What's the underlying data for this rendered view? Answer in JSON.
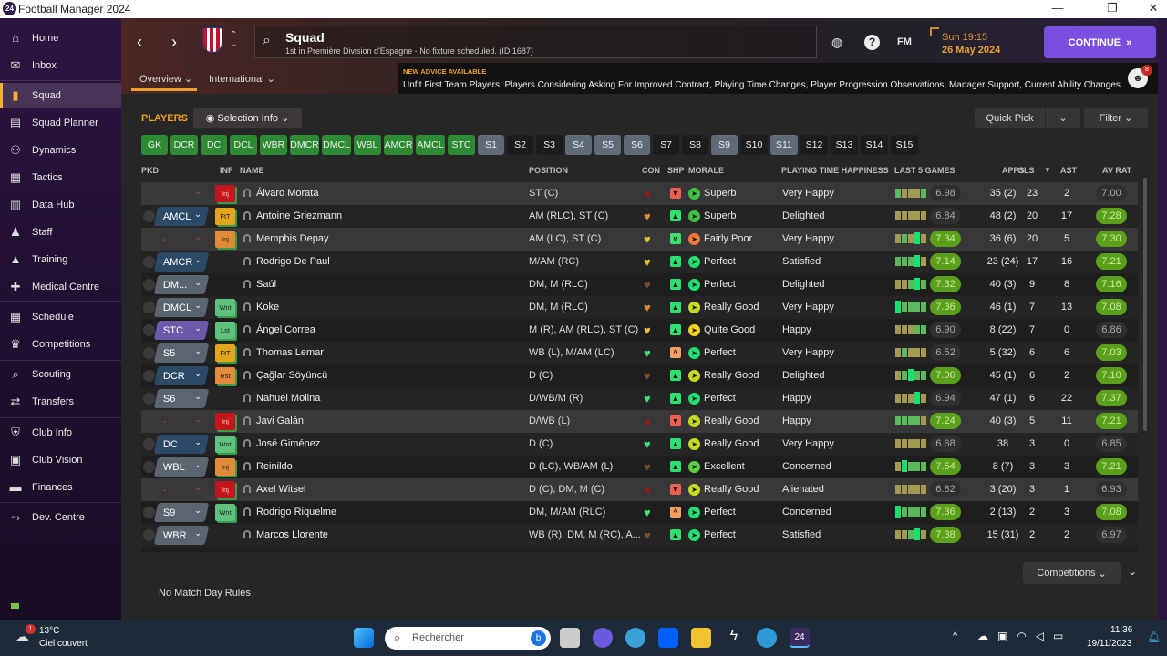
{
  "window": {
    "title": "Football Manager 2024",
    "logo": "24"
  },
  "sidebar": {
    "items": [
      {
        "label": "Home",
        "icon": "home-icon",
        "g": "⌂"
      },
      {
        "label": "Inbox",
        "icon": "inbox-icon",
        "g": "✉"
      },
      {
        "label": "Squad",
        "icon": "squad-icon",
        "g": "▮",
        "active": true
      },
      {
        "label": "Squad Planner",
        "icon": "clipboard-icon",
        "g": "▤"
      },
      {
        "label": "Dynamics",
        "icon": "dynamics-icon",
        "g": "⚇"
      },
      {
        "label": "Tactics",
        "icon": "tactics-icon",
        "g": "▦"
      },
      {
        "label": "Data Hub",
        "icon": "data-hub-icon",
        "g": "▥"
      },
      {
        "label": "Staff",
        "icon": "staff-icon",
        "g": "♟"
      },
      {
        "label": "Training",
        "icon": "training-icon",
        "g": "▲"
      },
      {
        "label": "Medical Centre",
        "icon": "medical-icon",
        "g": "✚"
      },
      {
        "label": "Schedule",
        "icon": "calendar-icon",
        "g": "▦"
      },
      {
        "label": "Competitions",
        "icon": "trophy-icon",
        "g": "♛"
      },
      {
        "label": "Scouting",
        "icon": "scouting-icon",
        "g": "⌕"
      },
      {
        "label": "Transfers",
        "icon": "transfers-icon",
        "g": "⇄"
      },
      {
        "label": "Club Info",
        "icon": "shield-icon",
        "g": "⛨"
      },
      {
        "label": "Club Vision",
        "icon": "vision-icon",
        "g": "▣"
      },
      {
        "label": "Finances",
        "icon": "finances-icon",
        "g": "▬"
      },
      {
        "label": "Dev. Centre",
        "icon": "dev-centre-icon",
        "g": "⤳"
      }
    ]
  },
  "header": {
    "title": "Squad",
    "subtitle": "1st in Première Division d'Espagne - No fixture scheduled. (ID:1687)",
    "tabs": [
      {
        "label": "Overview"
      },
      {
        "label": "International"
      }
    ],
    "time": "Sun 19:15",
    "date": "26 May 2024",
    "fm_label": "FM",
    "continue_label": "CONTINUE",
    "advice_title": "NEW ADVICE AVAILABLE",
    "advice_text": "Unfit First Team Players, Players Considering Asking For Improved Contract, Playing Time Changes, Player Progression Observations, Manager Support, Current Ability Changes",
    "notification_count": "8"
  },
  "squad": {
    "section_title": "PLAYERS",
    "selection_info": "Selection Info",
    "quick_pick": "Quick Pick",
    "filter": "Filter",
    "positions": [
      {
        "l": "GK",
        "s": "g"
      },
      {
        "l": "DCR",
        "s": "g"
      },
      {
        "l": "DC",
        "s": "g"
      },
      {
        "l": "DCL",
        "s": "g"
      },
      {
        "l": "WBR",
        "s": "g"
      },
      {
        "l": "DMCR",
        "s": "g"
      },
      {
        "l": "DMCL",
        "s": "g"
      },
      {
        "l": "WBL",
        "s": "g"
      },
      {
        "l": "AMCR",
        "s": "g"
      },
      {
        "l": "AMCL",
        "s": "g"
      },
      {
        "l": "STC",
        "s": "g"
      },
      {
        "l": "S1",
        "s": "s"
      },
      {
        "l": "S2",
        "s": "e"
      },
      {
        "l": "S3",
        "s": "e"
      },
      {
        "l": "S4",
        "s": "s"
      },
      {
        "l": "S5",
        "s": "s"
      },
      {
        "l": "S6",
        "s": "s"
      },
      {
        "l": "S7",
        "s": "e"
      },
      {
        "l": "S8",
        "s": "e"
      },
      {
        "l": "S9",
        "s": "s"
      },
      {
        "l": "S10",
        "s": "e"
      },
      {
        "l": "S11",
        "s": "s"
      },
      {
        "l": "S12",
        "s": "e"
      },
      {
        "l": "S13",
        "s": "e"
      },
      {
        "l": "S14",
        "s": "e"
      },
      {
        "l": "S15",
        "s": "e"
      }
    ],
    "columns": {
      "pkd": "PKD",
      "inf": "INF",
      "name": "NAME",
      "position": "POSITION",
      "con": "CON",
      "shp": "SHP",
      "morale": "MORALE",
      "pth": "PLAYING TIME HAPPINESS",
      "last5": "LAST 5 GAMES",
      "apps": "APPS",
      "gls": "GLS",
      "ast": "AST",
      "avrat": "AV RAT"
    },
    "rows": [
      {
        "pkd": "",
        "pc": "none",
        "inf": "Inj",
        "ic": "red",
        "name": "Álvaro Morata",
        "position": "ST (C)",
        "con": "injured",
        "shp": "down",
        "morale": "Superb",
        "pth": "Very Happy",
        "l5": "6.98",
        "bars": "gyyyg",
        "apps": "35 (2)",
        "gls": "23",
        "ast": "2",
        "avrat": "7.00",
        "hl": true
      },
      {
        "pkd": "AMCL",
        "pc": "blue",
        "inf": "FtT",
        "ic": "amber",
        "name": "Antoine Griezmann",
        "position": "AM (RLC), ST (C)",
        "con": "orange",
        "shp": "up",
        "morale": "Superb",
        "pth": "Delighted",
        "l5": "6.84",
        "bars": "yyyyy",
        "apps": "48 (2)",
        "gls": "20",
        "ast": "17",
        "avrat": "7.28"
      },
      {
        "pkd": "-",
        "pc": "none",
        "inf": "Inj",
        "ic": "orange",
        "name": "Memphis Depay",
        "position": "AM (LC), ST (C)",
        "con": "yellow",
        "shp": "chev-down",
        "morale": "Fairly Poor",
        "pth": "Very Happy",
        "l5": "7.34",
        "bars": "ygyGy",
        "apps": "36 (6)",
        "gls": "20",
        "ast": "5",
        "avrat": "7.30",
        "hl": true
      },
      {
        "pkd": "AMCR",
        "pc": "blue",
        "inf": "",
        "ic": "",
        "name": "Rodrigo De Paul",
        "position": "M/AM (RC)",
        "con": "yellow",
        "shp": "up",
        "morale": "Perfect",
        "pth": "Satisfied",
        "l5": "7.14",
        "bars": "gggGy",
        "apps": "23 (24)",
        "gls": "17",
        "ast": "16",
        "avrat": "7.21"
      },
      {
        "pkd": "DM...",
        "pc": "gray",
        "inf": "",
        "ic": "",
        "name": "Saúl",
        "position": "DM, M (RLC)",
        "con": "brown",
        "shp": "up",
        "morale": "Perfect",
        "pth": "Delighted",
        "l5": "7.32",
        "bars": "yygGg",
        "apps": "40 (3)",
        "gls": "9",
        "ast": "8",
        "avrat": "7.16"
      },
      {
        "pkd": "DMCL",
        "pc": "gray",
        "inf": "Wnt",
        "ic": "green",
        "name": "Koke",
        "position": "DM, M (RLC)",
        "con": "orange",
        "shp": "up",
        "morale": "Really Good",
        "pth": "Very Happy",
        "l5": "7.36",
        "bars": "Ggggg",
        "apps": "46 (1)",
        "gls": "7",
        "ast": "13",
        "avrat": "7.08"
      },
      {
        "pkd": "STC",
        "pc": "purple",
        "inf": "Lst",
        "ic": "green",
        "name": "Ángel Correa",
        "position": "M (R), AM (RLC), ST (C)",
        "con": "yellow",
        "shp": "up",
        "morale": "Quite Good",
        "pth": "Happy",
        "l5": "6.90",
        "bars": "yyygg",
        "apps": "8 (22)",
        "gls": "7",
        "ast": "0",
        "avrat": "6.86"
      },
      {
        "pkd": "S5",
        "pc": "gray",
        "inf": "FtT",
        "ic": "amber",
        "name": "Thomas Lemar",
        "position": "WB (L), M/AM (LC)",
        "con": "green",
        "shp": "chev-up",
        "morale": "Perfect",
        "pth": "Very Happy",
        "l5": "6.52",
        "bars": "ygyyy",
        "apps": "5 (32)",
        "gls": "6",
        "ast": "6",
        "avrat": "7.03"
      },
      {
        "pkd": "DCR",
        "pc": "blue",
        "inf": "Rst",
        "ic": "orange",
        "name": "Çağlar Söyüncü",
        "position": "D (C)",
        "con": "brown",
        "shp": "up",
        "morale": "Really Good",
        "pth": "Delighted",
        "l5": "7.06",
        "bars": "ygGgg",
        "apps": "45 (1)",
        "gls": "6",
        "ast": "2",
        "avrat": "7.10"
      },
      {
        "pkd": "S6",
        "pc": "gray",
        "inf": "",
        "ic": "",
        "name": "Nahuel Molina",
        "position": "D/WB/M (R)",
        "con": "green",
        "shp": "up",
        "morale": "Perfect",
        "pth": "Happy",
        "l5": "6.94",
        "bars": "yyyGy",
        "apps": "47 (1)",
        "gls": "6",
        "ast": "22",
        "avrat": "7.37"
      },
      {
        "pkd": "-",
        "pc": "none",
        "inf": "Inj",
        "ic": "red",
        "name": "Javi Galán",
        "position": "D/WB (L)",
        "con": "injured",
        "shp": "down",
        "morale": "Really Good",
        "pth": "Happy",
        "l5": "7.24",
        "bars": "ggggy",
        "apps": "40 (3)",
        "gls": "5",
        "ast": "11",
        "avrat": "7.21",
        "hl": true
      },
      {
        "pkd": "DC",
        "pc": "blue",
        "inf": "Wnt",
        "ic": "green",
        "name": "José Giménez",
        "position": "D (C)",
        "con": "green",
        "shp": "up",
        "morale": "Really Good",
        "pth": "Very Happy",
        "l5": "6.68",
        "bars": "yyyyy",
        "apps": "38",
        "gls": "3",
        "ast": "0",
        "avrat": "6.85"
      },
      {
        "pkd": "WBL",
        "pc": "gray",
        "inf": "Inj",
        "ic": "orange",
        "name": "Reinildo",
        "position": "D (LC), WB/AM (L)",
        "con": "brown",
        "shp": "up",
        "morale": "Excellent",
        "pth": "Concerned",
        "l5": "7.54",
        "bars": "yGggg",
        "apps": "8 (7)",
        "gls": "3",
        "ast": "3",
        "avrat": "7.21"
      },
      {
        "pkd": "-",
        "pc": "none",
        "inf": "Inj",
        "ic": "red",
        "name": "Axel Witsel",
        "position": "D (C), DM, M (C)",
        "con": "injured",
        "shp": "down",
        "morale": "Really Good",
        "pth": "Alienated",
        "l5": "6.82",
        "bars": "yyyyy",
        "apps": "3 (20)",
        "gls": "3",
        "ast": "1",
        "avrat": "6.93",
        "hl": true
      },
      {
        "pkd": "S9",
        "pc": "gray",
        "inf": "Wnt",
        "ic": "green",
        "name": "Rodrigo Riquelme",
        "position": "DM, M/AM (RLC)",
        "con": "green",
        "shp": "chev-up",
        "morale": "Perfect",
        "pth": "Concerned",
        "l5": "7.36",
        "bars": "Ggggg",
        "apps": "2 (13)",
        "gls": "2",
        "ast": "3",
        "avrat": "7.08"
      },
      {
        "pkd": "WBR",
        "pc": "gray",
        "inf": "",
        "ic": "",
        "name": "Marcos Llorente",
        "position": "WB (R), DM, M (RC), A...",
        "con": "brown",
        "shp": "up",
        "morale": "Perfect",
        "pth": "Satisfied",
        "l5": "7.38",
        "bars": "yygGy",
        "apps": "15 (31)",
        "gls": "2",
        "ast": "2",
        "avrat": "6.97"
      }
    ],
    "footer_rules": "No Match Day Rules",
    "competitions_label": "Competitions"
  },
  "taskbar": {
    "weather_temp": "13°C",
    "weather_text": "Ciel couvert",
    "weather_badge": "1",
    "search_placeholder": "Rechercher",
    "time": "11:36",
    "date": "19/11/2023"
  }
}
